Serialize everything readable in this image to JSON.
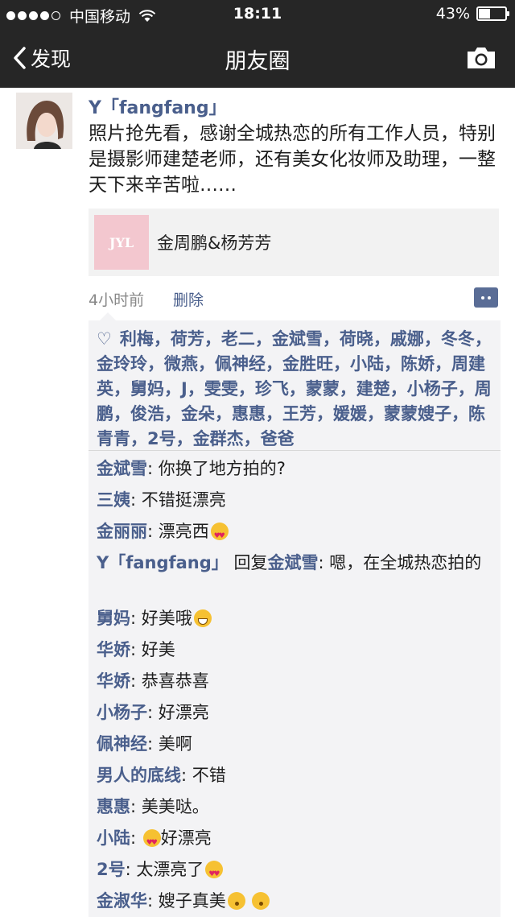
{
  "status_bar": {
    "carrier": "中国移动",
    "time": "18:11",
    "battery": "43%",
    "battery_level": 0.43
  },
  "nav": {
    "back_label": "发现",
    "title": "朋友圈"
  },
  "post": {
    "author": "Y「fangfang」",
    "text": "照片抢先看，感谢全城热恋的所有工作人员，特别是摄影师建楚老师，还有美女化妆师及助理，一整天下来辛苦啦……",
    "link_card": {
      "thumb_logo": "JYL",
      "title": "金周鹏&杨芳芳"
    },
    "time_ago": "4小时前",
    "delete_label": "删除"
  },
  "likes": "利梅，荷芳，老二，金斌雪，荷晓，戚娜，冬冬，金玲玲，微燕，佩神经，金胜旺，小陆，陈娇，周建英，舅妈，J，雯雯，珍飞，蒙蒙，建楚，小杨子，周鹏，俊浩，金朵，惠惠，王芳，媛媛，蒙蒙嫂子，陈青青，2号，金群杰，爸爸",
  "comments": [
    {
      "author": "金斌雪",
      "text": ": 你换了地方拍的?"
    },
    {
      "author": "三姨",
      "text": ": 不错挺漂亮"
    },
    {
      "author": "金丽丽",
      "text": ": 漂亮西"
    },
    {
      "author": "Y「fangfang」",
      "reply_word": " 回复",
      "reply_to": "金斌雪",
      "text": ": 嗯，在全城热恋拍的"
    },
    {
      "author": "舅妈",
      "text": ": 好美哦"
    },
    {
      "author": "华娇",
      "text": ": 好美"
    },
    {
      "author": "华娇",
      "text": ": 恭喜恭喜"
    },
    {
      "author": "小杨子",
      "text": ": 好漂亮"
    },
    {
      "author": "佩神经",
      "text": ": 美啊"
    },
    {
      "author": "男人的底线",
      "text": ": 不错"
    },
    {
      "author": "惠惠",
      "text": ": 美美哒。"
    },
    {
      "author": "小陆",
      "text": ": ",
      "text2": "好漂亮"
    },
    {
      "author": "2号",
      "text": ": 太漂亮了"
    },
    {
      "author": "金淑华",
      "text": ": 嫂子真美"
    }
  ]
}
